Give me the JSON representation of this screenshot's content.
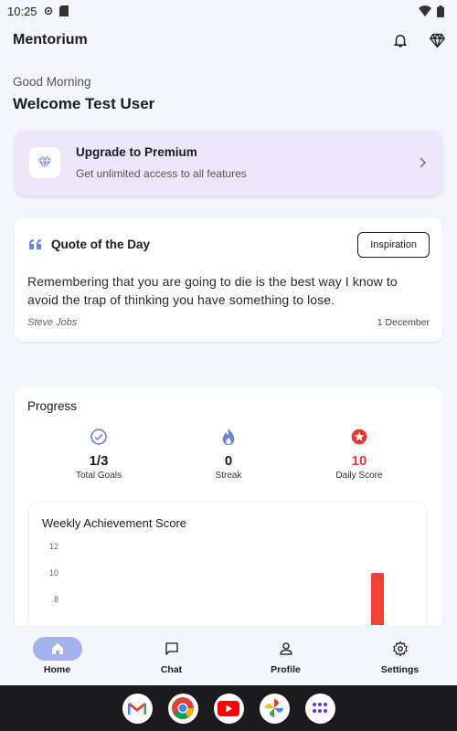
{
  "status_bar": {
    "time": "10:25"
  },
  "app": {
    "title": "Mentorium"
  },
  "greeting": "Good Morning",
  "welcome": "Welcome Test User",
  "premium": {
    "title": "Upgrade to Premium",
    "subtitle": "Get unlimited access to all features"
  },
  "quote": {
    "section_title": "Quote of the Day",
    "tag": "Inspiration",
    "text": "Remembering that you are going to die is the best way I know to avoid the trap of thinking you have something to lose.",
    "author": "Steve Jobs",
    "date": "1 December"
  },
  "progress": {
    "title": "Progress",
    "stats": [
      {
        "value": "1/3",
        "label": "Total Goals",
        "icon": "check-circle-icon",
        "color": "#6b84d6"
      },
      {
        "value": "0",
        "label": "Streak",
        "icon": "flame-icon",
        "color": "#6b84d6"
      },
      {
        "value": "10",
        "label": "Daily Score",
        "icon": "star-badge-icon",
        "color": "#e53935"
      }
    ]
  },
  "chart_data": {
    "type": "bar",
    "title": "Weekly Achievement Score",
    "yticks": [
      12,
      10,
      8
    ],
    "ylim": [
      0,
      12
    ],
    "values": [
      0,
      0,
      0,
      0,
      0,
      0,
      10
    ],
    "bar_color": "#f44336"
  },
  "nav": {
    "items": [
      {
        "label": "Home",
        "icon": "home-icon",
        "active": true
      },
      {
        "label": "Chat",
        "icon": "chat-icon",
        "active": false
      },
      {
        "label": "Profile",
        "icon": "person-icon",
        "active": false
      },
      {
        "label": "Settings",
        "icon": "gear-icon",
        "active": false
      }
    ]
  },
  "dock": [
    "gmail-icon",
    "chrome-icon",
    "youtube-icon",
    "photos-icon",
    "apps-icon"
  ]
}
